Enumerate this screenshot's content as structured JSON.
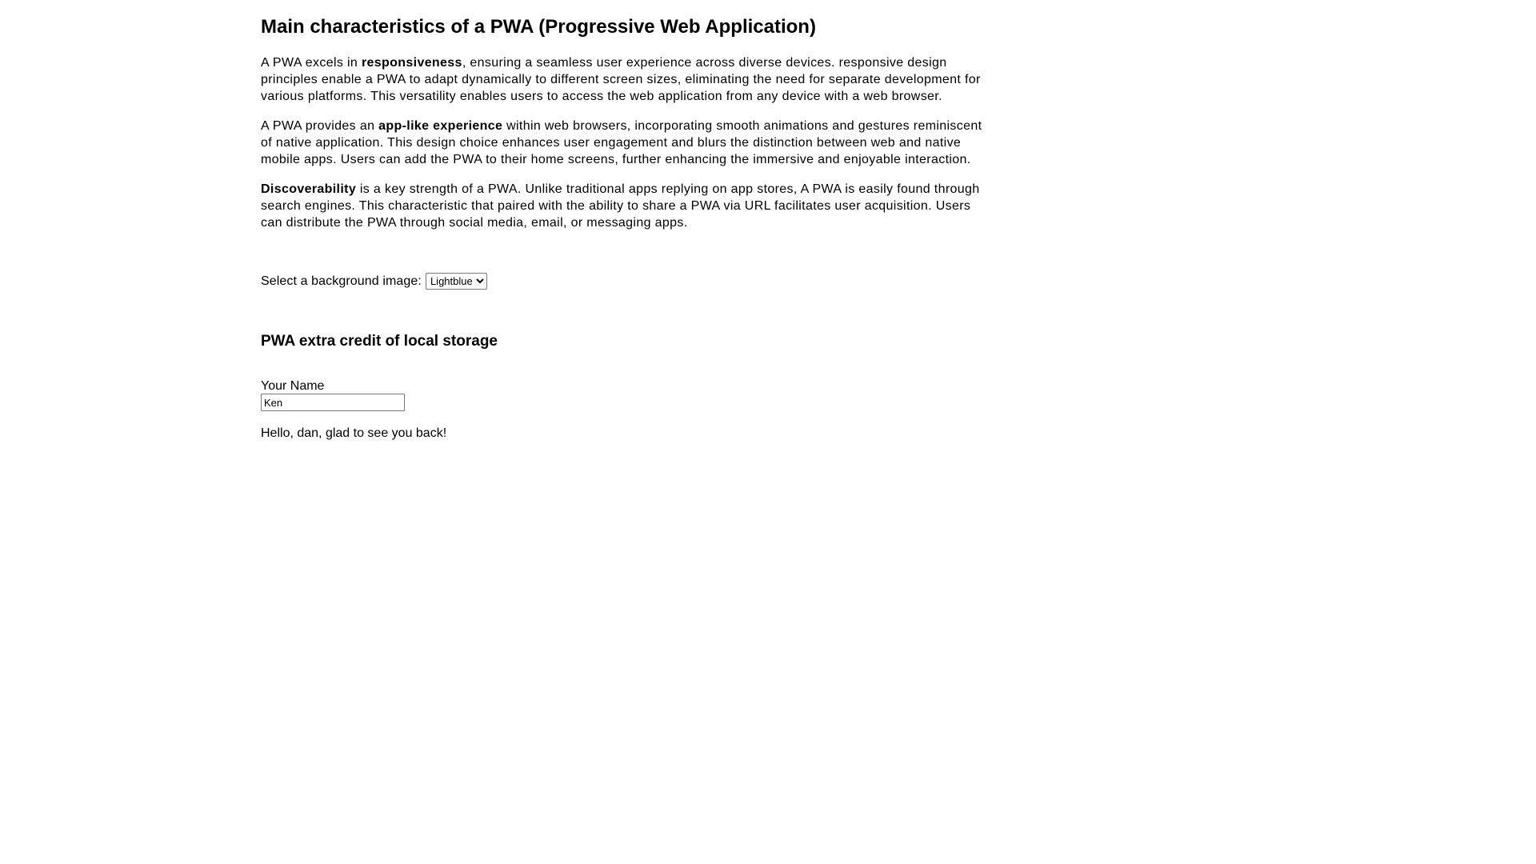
{
  "page": {
    "title": "Main characteristics of a PWA (Progressive Web Application)"
  },
  "paragraphs": [
    {
      "pre": "A PWA excels in ",
      "bold": "responsiveness",
      "post": ", ensuring a seamless user experience across diverse devices. responsive design principles enable a PWA to adapt dynamically to different screen sizes, eliminating the need for separate development for various platforms. This versatility enables users to access the web application from any device with a web browser."
    },
    {
      "pre": "A PWA provides an ",
      "bold": "app-like experience",
      "post": " within web browsers, incorporating smooth animations and gestures reminiscent of native application. This design choice enhances user engagement and blurs the distinction between web and native mobile apps. Users can add the PWA to their home screens, further enhancing the immersive and enjoyable interaction."
    },
    {
      "pre": "",
      "bold": "Discoverability",
      "post": " is a key strength of a PWA. Unlike traditional apps replying on app stores, A PWA is easily found through search engines. This characteristic that paired with the ability to share a PWA via URL facilitates user acquisition. Users can distribute the PWA through social media, email, or messaging apps."
    }
  ],
  "background": {
    "label": "Select a background image:",
    "selected": "Lightblue"
  },
  "storage": {
    "title": "PWA extra credit of local storage",
    "name_label": "Your Name",
    "name_value": "Ken",
    "greeting": "Hello, dan, glad to see you back!"
  }
}
